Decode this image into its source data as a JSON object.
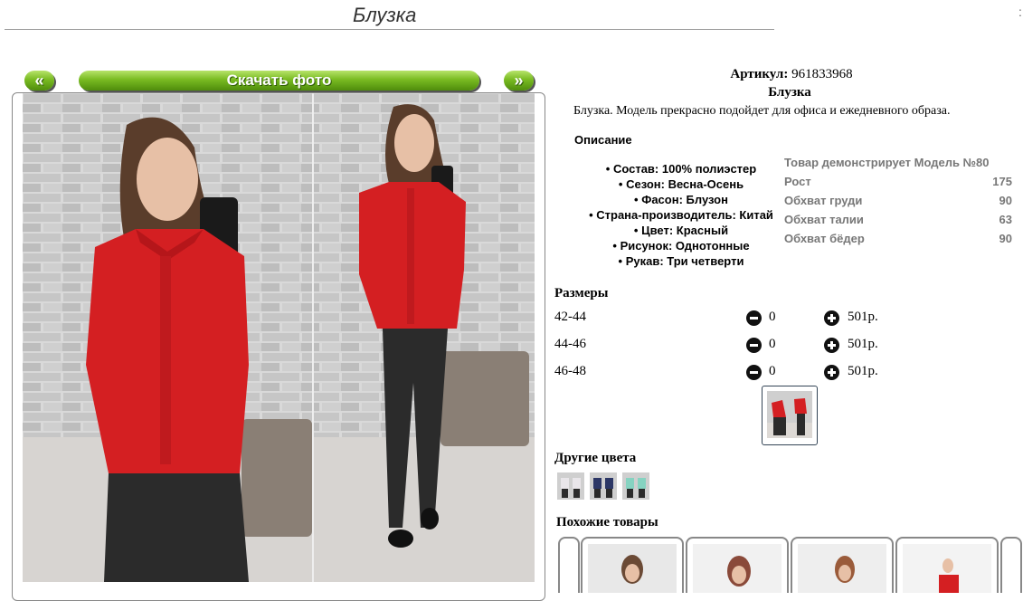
{
  "page": {
    "title": "Блузка",
    "edge_mark": ":"
  },
  "gallery": {
    "prev_label": "«",
    "download_label": "Скачать фото",
    "next_label": "»"
  },
  "product": {
    "article_label": "Артикул:",
    "article_value": "961833968",
    "name": "Блузка",
    "description": "Блузка. Модель прекрасно подойдет для офиса и ежедневного образа.",
    "description_heading": "Описание",
    "attributes": [
      "Состав: 100% полиэстер",
      "Сезон: Весна-Осень",
      "Фасон: Блузон",
      "Страна-производитель: Китай",
      "Цвет: Красный",
      "Рисунок: Однотонные",
      "Рукав: Три четверти"
    ]
  },
  "model": {
    "heading": "Товар демонстрирует Модель №80",
    "rows": [
      {
        "label": "Рост",
        "value": "175"
      },
      {
        "label": "Обхват груди",
        "value": "90"
      },
      {
        "label": "Обхват талии",
        "value": "63"
      },
      {
        "label": "Обхват бёдер",
        "value": "90"
      }
    ]
  },
  "sizes": {
    "heading": "Размеры",
    "rows": [
      {
        "size": "42-44",
        "qty": "0",
        "price": "501р."
      },
      {
        "size": "44-46",
        "qty": "0",
        "price": "501р."
      },
      {
        "size": "46-48",
        "qty": "0",
        "price": "501р."
      }
    ]
  },
  "other_colors": {
    "heading": "Другие цвета",
    "swatches": [
      "#e9e6ea",
      "#2c3766",
      "#86d3c1"
    ]
  },
  "similar": {
    "heading": "Похожие товары"
  },
  "colors": {
    "accent_green": "#6aaa1a",
    "blouse_red": "#d41f22",
    "icon_dark": "#111111"
  }
}
